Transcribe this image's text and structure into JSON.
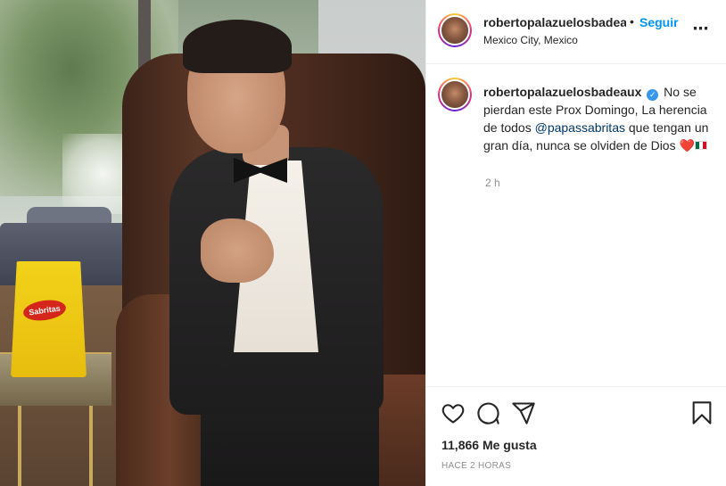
{
  "post": {
    "username": "robertopalazuelosbadeaux",
    "header_username": "robertopalazuelosbadea…",
    "follow_label": "Seguir",
    "separator": "•",
    "location": "Mexico City, Mexico",
    "more_icon": "more-icon",
    "caption_text_1": "No se pierdan este Prox Domingo, La herencia de todos ",
    "caption_mention": "@papassabritas",
    "caption_text_2": " que tengan un gran día, nunca se olviden de Dios ",
    "caption_emoji_heart": "❤️",
    "time_ago": "2 h",
    "likes": "11,866 Me gusta",
    "posted_label": "HACE 2 HORAS",
    "verified_icon": "verified-badge-icon"
  },
  "photo": {
    "bag_logo": "Sabritas"
  },
  "actions": {
    "like_icon": "heart-icon",
    "comment_icon": "comment-icon",
    "share_icon": "share-icon",
    "save_icon": "bookmark-icon"
  },
  "colors": {
    "link_blue": "#0095f6",
    "mention": "#00376b",
    "verified": "#3897f0",
    "text": "#262626",
    "muted": "#8e8e8e"
  }
}
